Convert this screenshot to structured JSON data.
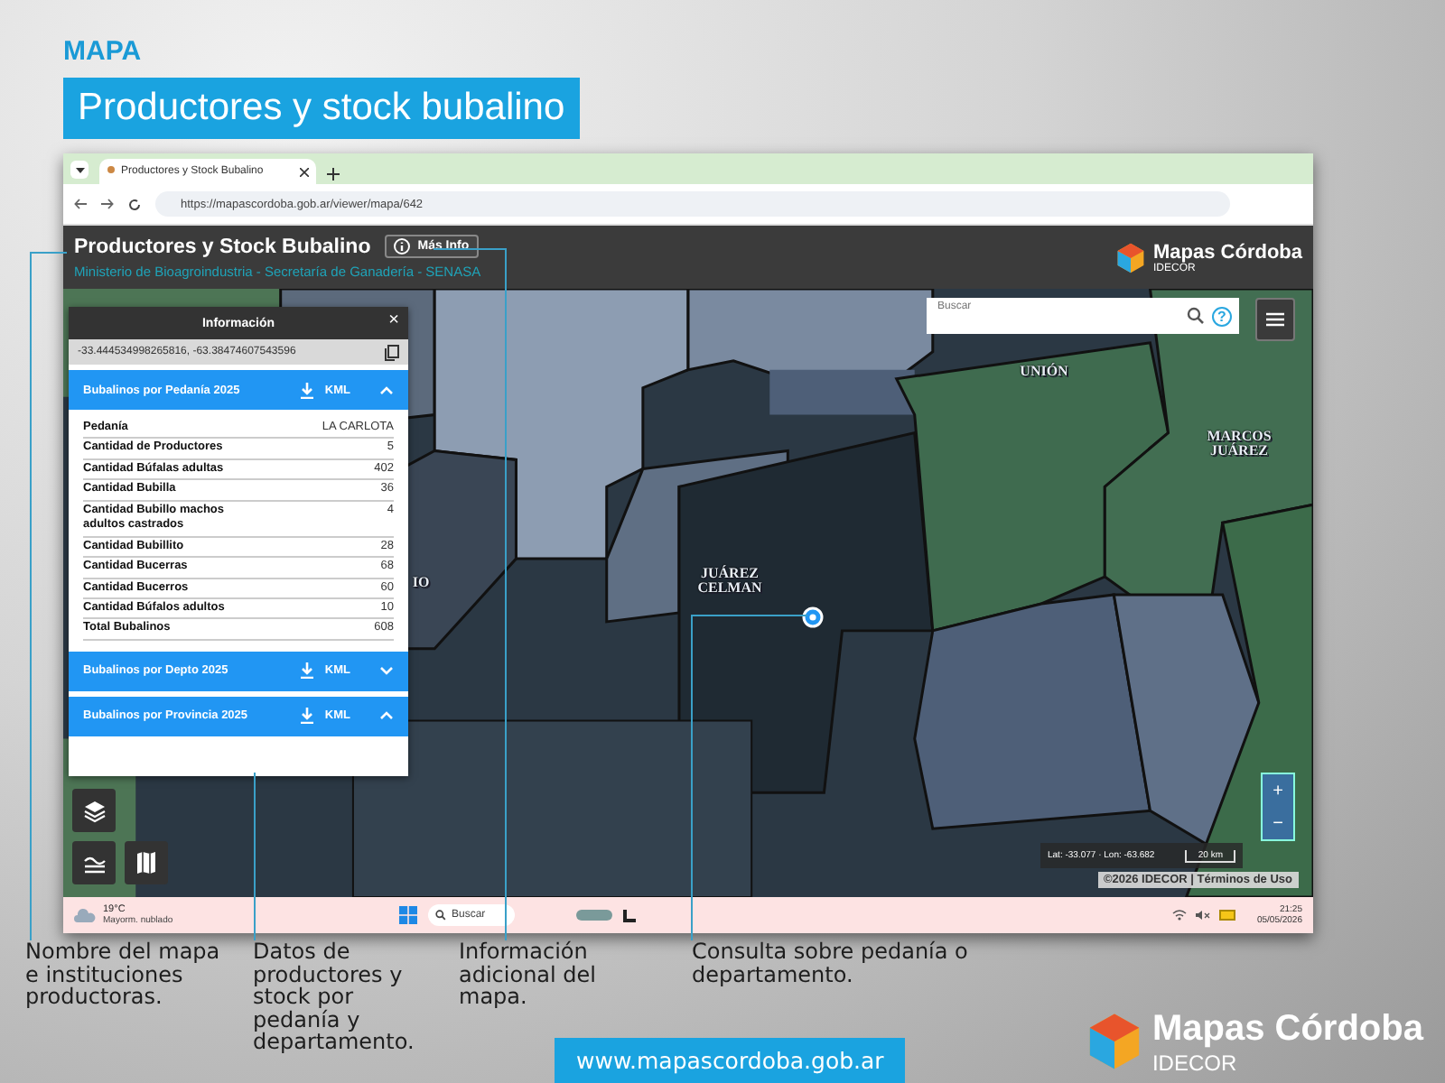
{
  "header": {
    "kicker": "MAPA",
    "title": "Productores y stock bubalino"
  },
  "browser": {
    "tab_title": "Productores y Stock Bubalino",
    "url": "https://mapascordoba.gob.ar/viewer/mapa/642"
  },
  "app_header": {
    "title": "Productores y Stock Bubalino",
    "info_button": "Más Info",
    "subtitle": "Ministerio de Bioagroindustria - Secretaría de Ganadería - SENASA",
    "logo": {
      "name": "Mapas Córdoba",
      "sub": "IDECOR"
    }
  },
  "map": {
    "search": {
      "placeholder": "Buscar"
    },
    "help": "?",
    "labels": [
      {
        "text": "UNIÓN"
      },
      {
        "text": "MARCOS JUÁREZ"
      },
      {
        "text": "IO"
      },
      {
        "text": "JUÁREZ CELMAN"
      }
    ],
    "zoom_in": "+",
    "zoom_out": "−",
    "coordinates": "Lat: -33.077 · Lon: -63.682",
    "scale": "20 km",
    "attribution": "©2026 IDECOR | Términos de Uso"
  },
  "info_panel": {
    "title": "Información",
    "close": "×",
    "coordinates": "-33.444534998265816, -63.38474607543596",
    "sections": [
      {
        "title": "Bubalinos por Pedanía 2025",
        "download": "KML",
        "expanded": true,
        "rows": [
          {
            "label": "Pedanía",
            "value": "LA CARLOTA"
          },
          {
            "label": "Cantidad de Productores",
            "value": "5"
          },
          {
            "label": "Cantidad Búfalas adultas",
            "value": "402"
          },
          {
            "label": "Cantidad Bubilla",
            "value": "36"
          },
          {
            "label": "Cantidad Bubillo machos adultos castrados",
            "value": "4"
          },
          {
            "label": "Cantidad Bubillito",
            "value": "28"
          },
          {
            "label": "Cantidad Bucerras",
            "value": "68"
          },
          {
            "label": "Cantidad Bucerros",
            "value": "60"
          },
          {
            "label": "Cantidad Búfalos adultos",
            "value": "10"
          },
          {
            "label": "Total Bubalinos",
            "value": "608"
          }
        ]
      },
      {
        "title": "Bubalinos por Depto 2025",
        "download": "KML",
        "expanded": false
      },
      {
        "title": "Bubalinos por Provincia 2025",
        "download": "KML",
        "expanded": true
      }
    ]
  },
  "taskbar": {
    "weather": {
      "temp": "19°C",
      "desc": "Mayorm. nublado"
    },
    "search": "Buscar",
    "time": "21:25",
    "date": "05/05/2026"
  },
  "captions": [
    "Nombre del mapa e instituciones productoras.",
    "Datos de productores y stock por pedanía y departamento.",
    "Información adicional del mapa.",
    "Consulta sobre pedanía o departamento."
  ],
  "url_button": "www.mapascordoba.gob.ar",
  "footer_logo": {
    "name": "Mapas Córdoba",
    "sub": "IDECOR"
  }
}
